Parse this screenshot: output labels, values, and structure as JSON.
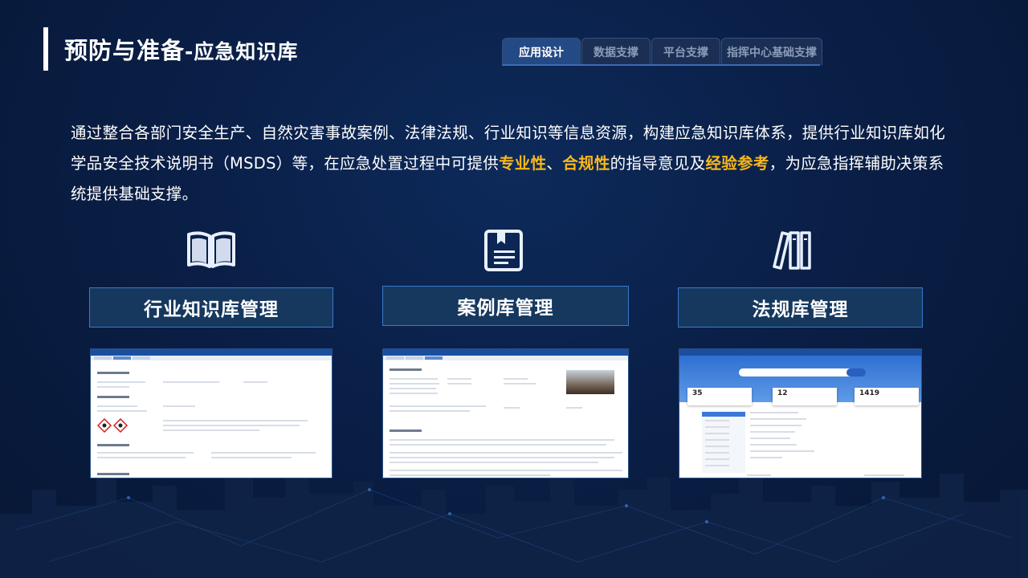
{
  "header": {
    "title_main": "预防与准备",
    "title_sub": "-应急知识库"
  },
  "tabs": [
    {
      "label": "应用设计",
      "active": true
    },
    {
      "label": "数据支撑",
      "active": false
    },
    {
      "label": "平台支撑",
      "active": false
    },
    {
      "label": "指挥中心基础支撑",
      "active": false
    }
  ],
  "intro": {
    "part1": "通过整合各部门安全生产、自然灾害事故案例、法律法规、行业知识等信息资源，构建应急知识库体系，提供行业知识库如化学品安全技术说明书（MSDS）等，在应急处置过程中可提供",
    "hl1": "专业性",
    "sep1": "、",
    "hl2": "合规性",
    "part2": "的指导意见及",
    "hl3": "经验参考",
    "part3": "，为应急指挥辅助决策系统提供基础支撑。"
  },
  "cards": [
    {
      "title": "行业知识库管理",
      "icon": "open-book-icon"
    },
    {
      "title": "案例库管理",
      "icon": "document-book-icon"
    },
    {
      "title": "法规库管理",
      "icon": "books-shelf-icon"
    }
  ],
  "screens": {
    "law": {
      "stats": [
        {
          "value": "35"
        },
        {
          "value": "12"
        },
        {
          "value": "1419"
        }
      ]
    }
  },
  "colors": {
    "accent": "#f9b81a",
    "card_bg": "#16385f",
    "card_border": "#3a78c9"
  }
}
